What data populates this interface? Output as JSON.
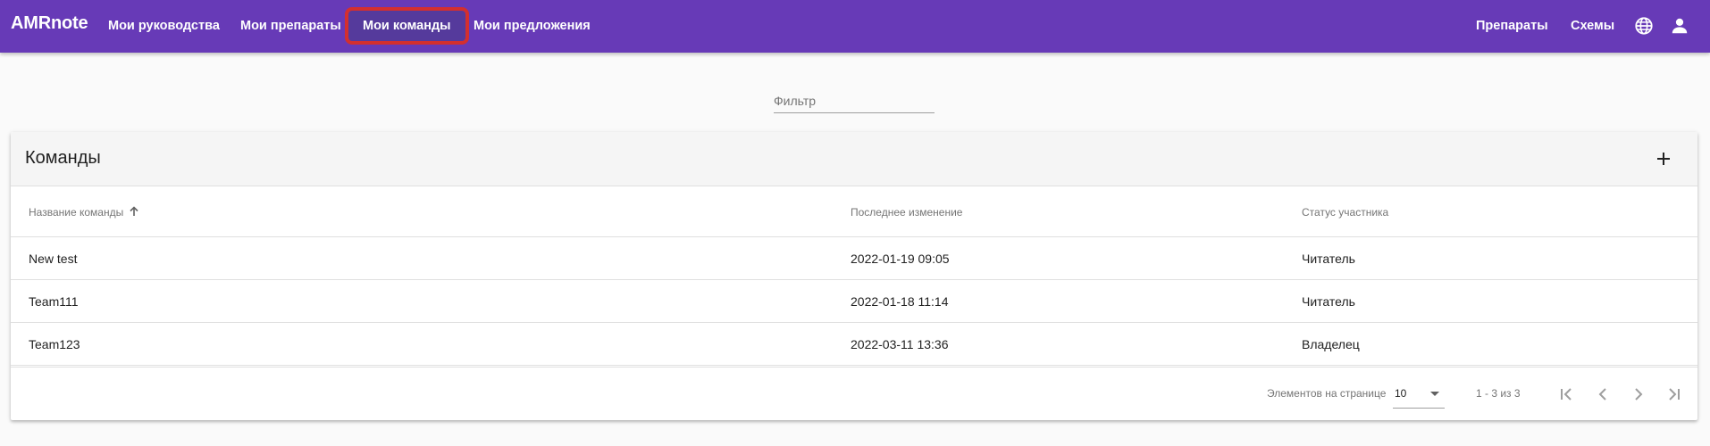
{
  "brand": "AMRnote",
  "nav": {
    "items": [
      {
        "label": "Мои руководства"
      },
      {
        "label": "Мои препараты"
      },
      {
        "label": "Мои команды"
      },
      {
        "label": "Мои предложения"
      }
    ],
    "active_index": 2,
    "right_links": [
      {
        "label": "Препараты"
      },
      {
        "label": "Схемы"
      }
    ],
    "icons": [
      "globe-icon",
      "account-icon"
    ]
  },
  "filter": {
    "placeholder": "Фильтр",
    "value": ""
  },
  "card": {
    "title": "Команды",
    "add_icon": "plus-icon",
    "columns": [
      {
        "label": "Название команды",
        "sort": "ascending"
      },
      {
        "label": "Последнее изменение"
      },
      {
        "label": "Статус участника"
      }
    ],
    "rows": [
      {
        "name": "New test",
        "modified": "2022-01-19 09:05",
        "status": "Читатель"
      },
      {
        "name": "Team111",
        "modified": "2022-01-18 11:14",
        "status": "Читатель"
      },
      {
        "name": "Team123",
        "modified": "2022-03-11 13:36",
        "status": "Владелец"
      }
    ]
  },
  "paginator": {
    "items_per_page_label": "Элементов на странице",
    "page_size": "10",
    "range_label": "1 - 3 из 3",
    "icons": [
      "first-page-icon",
      "previous-page-icon",
      "next-page-icon",
      "last-page-icon"
    ]
  },
  "colors": {
    "toolbar": "#673ab7",
    "active_nav": "#553a9c",
    "highlight_outline": "#d32f2f",
    "background": "#fafafa",
    "card_header": "#f5f5f5"
  }
}
